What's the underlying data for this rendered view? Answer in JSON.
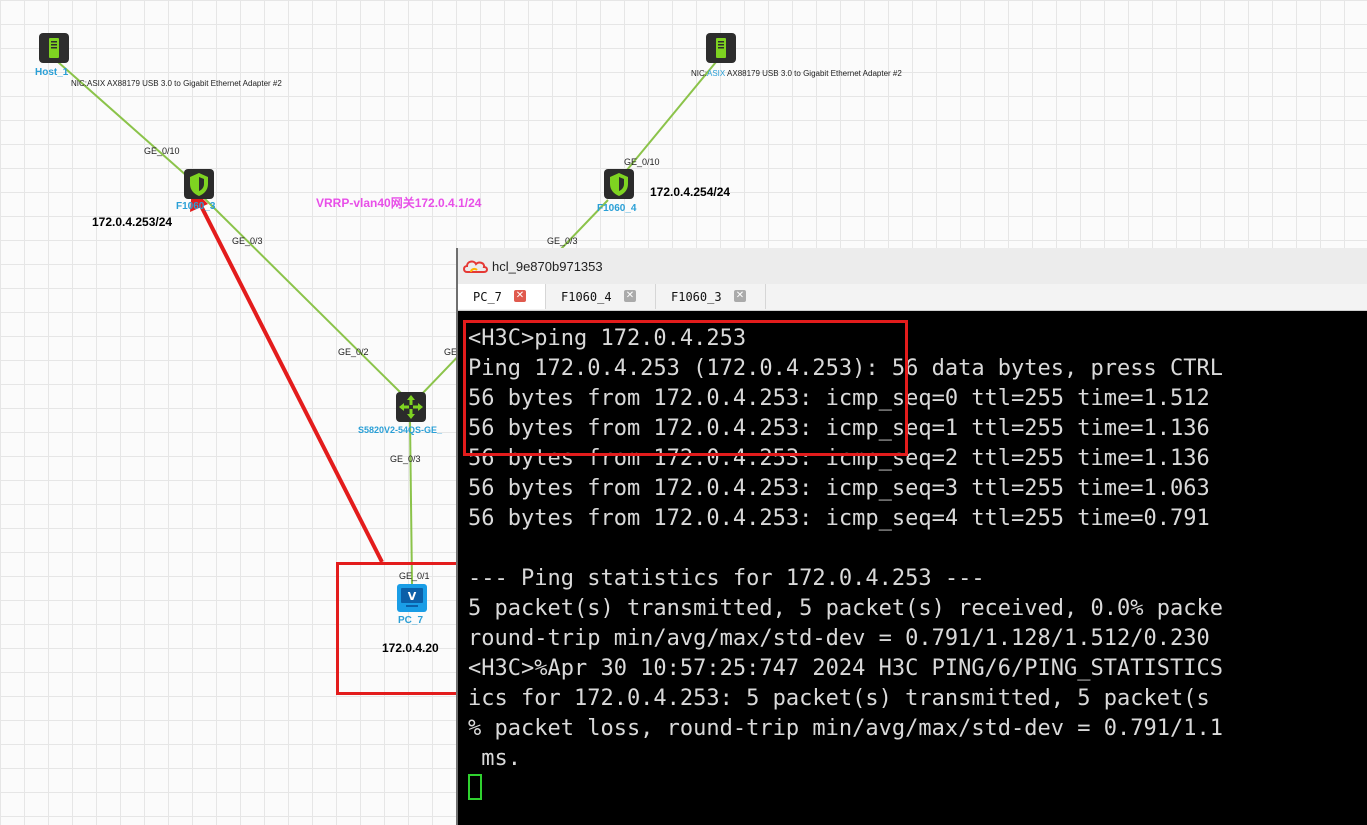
{
  "topology": {
    "devices": {
      "host1": {
        "name": "Host_1",
        "nic": "NIC:ASIX AX88179 USB 3.0 to Gigabit Ethernet Adapter #2"
      },
      "host2": {
        "name_partial": "ASIX",
        "nic_prefix": "NIC:",
        "nic_rest": "AX88179 USB 3.0 to Gigabit Ethernet Adapter #2"
      },
      "fw3": {
        "name": "F1060_3",
        "ip": "172.0.4.253/24",
        "port_up": "GE_0/10",
        "port_down": "GE_0/3"
      },
      "fw4": {
        "name": "F1060_4",
        "ip": "172.0.4.254/24",
        "port_up": "GE_0/10",
        "port_down": "GE_0/3"
      },
      "switch": {
        "name": "S5820V2-54QS-GE_",
        "port_left": "GE_0/2",
        "port_right": "GE",
        "port_down": "GE_0/3"
      },
      "pc7": {
        "name": "PC_7",
        "ip": "172.0.4.20",
        "port": "GE_0/1"
      }
    },
    "vrrp_label": "VRRP-vlan40网关172.0.4.1/24",
    "colors": {
      "link": "#8bc34a",
      "annotation": "#e31c1c",
      "vrrp": "#e84fe8",
      "device_name": "#2a9fd6"
    }
  },
  "terminal": {
    "title": "hcl_9e870b971353",
    "tabs": [
      {
        "label": "PC_7",
        "active": true
      },
      {
        "label": "F1060_4",
        "active": false
      },
      {
        "label": "F1060_3",
        "active": false
      }
    ],
    "lines": [
      "<H3C>ping 172.0.4.253",
      "Ping 172.0.4.253 (172.0.4.253): 56 data bytes, press CTRL",
      "56 bytes from 172.0.4.253: icmp_seq=0 ttl=255 time=1.512",
      "56 bytes from 172.0.4.253: icmp_seq=1 ttl=255 time=1.136",
      "56 bytes from 172.0.4.253: icmp_seq=2 ttl=255 time=1.136",
      "56 bytes from 172.0.4.253: icmp_seq=3 ttl=255 time=1.063",
      "56 bytes from 172.0.4.253: icmp_seq=4 ttl=255 time=0.791",
      "",
      "--- Ping statistics for 172.0.4.253 ---",
      "5 packet(s) transmitted, 5 packet(s) received, 0.0% packe",
      "round-trip min/avg/max/std-dev = 0.791/1.128/1.512/0.230",
      "<H3C>%Apr 30 10:57:25:747 2024 H3C PING/6/PING_STATISTICS",
      "ics for 172.0.4.253: 5 packet(s) transmitted, 5 packet(s",
      "% packet loss, round-trip min/avg/max/std-dev = 0.791/1.1",
      " ms."
    ]
  }
}
